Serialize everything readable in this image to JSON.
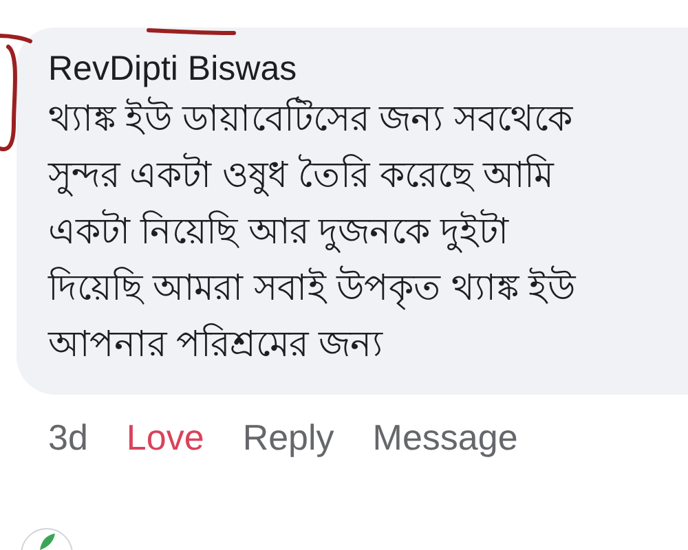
{
  "comment": {
    "author": "RevDipti Biswas",
    "lines": [
      "থ্যাঙ্ক ইউ ডায়াবেটিসের জন্য সবথেকে",
      "সুন্দর একটা ওষুধ তৈরি করেছে আমি",
      "একটা নিয়েছি আর দুজনকে দুইটা",
      "দিয়েছি আমরা সবাই উপকৃত থ্যাঙ্ক ইউ",
      "আপনার পরিশ্রমের জন্য"
    ],
    "time": "3d",
    "actions": [
      {
        "label": "Love",
        "selected": true
      },
      {
        "label": "Reply",
        "selected": false
      },
      {
        "label": "Message",
        "selected": false
      }
    ]
  }
}
